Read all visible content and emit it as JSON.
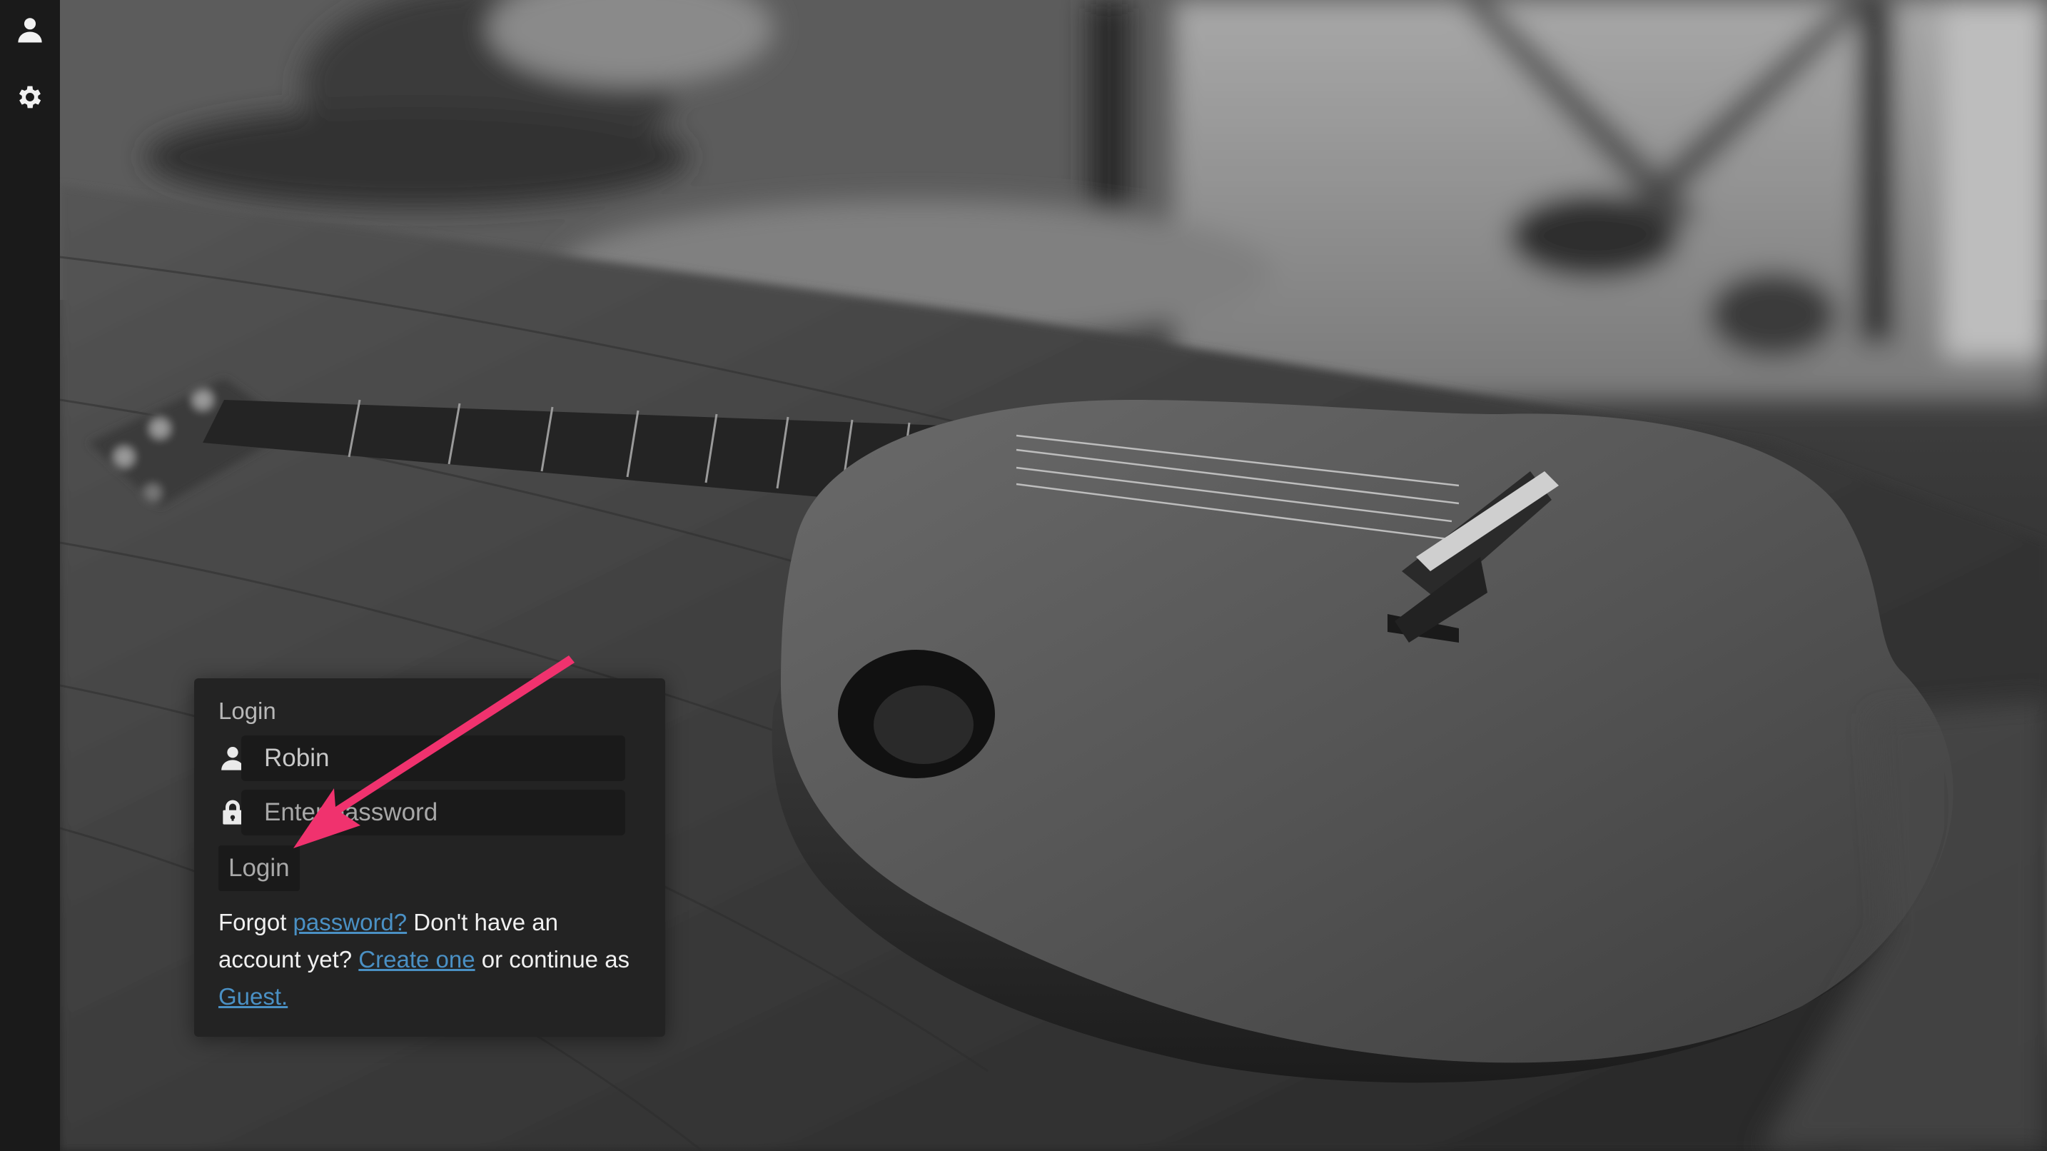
{
  "sidebar": {
    "items": [
      {
        "icon": "user-icon"
      },
      {
        "icon": "gear-icon"
      }
    ]
  },
  "background": {
    "subject": "ukulele-photo"
  },
  "login": {
    "title": "Login",
    "username_value": "Robin",
    "password_placeholder": "Enter password",
    "button_label": "Login",
    "footer": {
      "text_1": "Forgot ",
      "link_password": "password?",
      "text_2": " Don't have an account yet? ",
      "link_create": "Create one",
      "text_3": " or continue as ",
      "link_guest": "Guest."
    }
  },
  "annotation": {
    "type": "arrow",
    "color": "#f0326e",
    "target": "login-button"
  },
  "colors": {
    "sidebar_bg": "#1a1a1a",
    "panel_bg": "#232323",
    "input_bg": "#1a1a1a",
    "link": "#4a90c4",
    "arrow": "#f0326e"
  }
}
